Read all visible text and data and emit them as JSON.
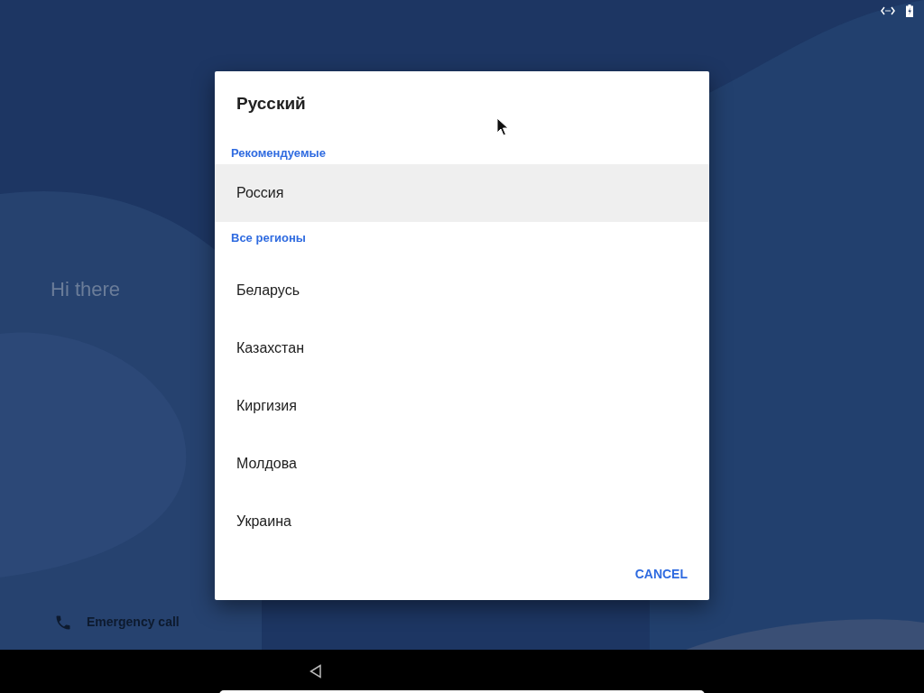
{
  "greeting": "Hi there",
  "emergency": {
    "label": "Emergency call"
  },
  "dialog": {
    "title": "Русский",
    "sections": [
      {
        "heading": "Рекомендуемые",
        "items": [
          {
            "label": "Россия",
            "selected": true
          }
        ]
      },
      {
        "heading": "Все регионы",
        "items": [
          {
            "label": "Беларусь",
            "selected": false
          },
          {
            "label": "Казахстан",
            "selected": false
          },
          {
            "label": "Киргизия",
            "selected": false
          },
          {
            "label": "Молдова",
            "selected": false
          },
          {
            "label": "Украина",
            "selected": false
          }
        ]
      }
    ],
    "buttons": [
      "CANCEL"
    ]
  }
}
